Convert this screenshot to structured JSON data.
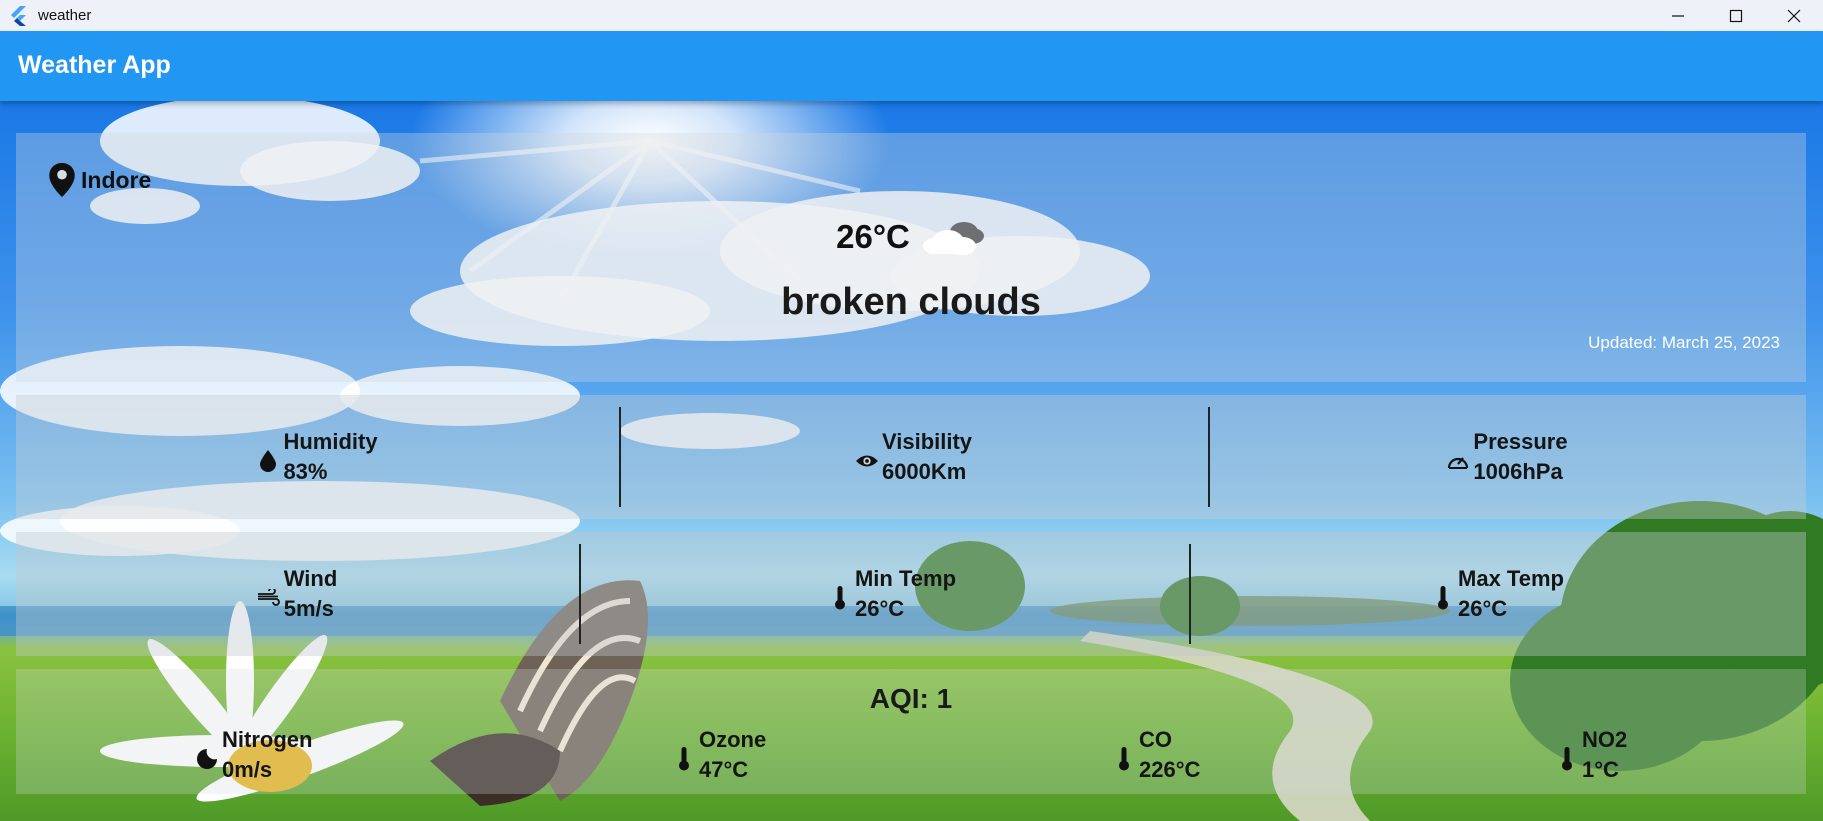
{
  "window": {
    "title": "weather",
    "controls": {
      "minimize": "minimize-icon",
      "maximize": "maximize-icon",
      "close": "close-icon"
    }
  },
  "appbar": {
    "title": "Weather App",
    "color": "#2196f3"
  },
  "current": {
    "city": "Indore",
    "temperature": "26°C",
    "condition_icon": "broken-clouds-icon",
    "description": "broken clouds",
    "updated": "Updated: March 25, 2023"
  },
  "details_row1": [
    {
      "icon": "water-drop-icon",
      "label": "Humidity",
      "value": "83%"
    },
    {
      "icon": "eye-icon",
      "label": "Visibility",
      "value": "6000Km"
    },
    {
      "icon": "speedometer-icon",
      "label": "Pressure",
      "value": "1006hPa"
    }
  ],
  "details_row2": [
    {
      "icon": "wind-icon",
      "label": "Wind",
      "value": "5m/s"
    },
    {
      "icon": "thermometer-icon",
      "label": "Min Temp",
      "value": "26°C"
    },
    {
      "icon": "thermometer-icon",
      "label": "Max Temp",
      "value": "26°C"
    }
  ],
  "aqi": {
    "title": "AQI: 1",
    "items": [
      {
        "icon": "moon-icon",
        "label": "Nitrogen",
        "value": "0m/s"
      },
      {
        "icon": "thermometer-icon",
        "label": "Ozone",
        "value": "47°C"
      },
      {
        "icon": "thermometer-icon",
        "label": "CO",
        "value": "226°C"
      },
      {
        "icon": "thermometer-icon",
        "label": "NO2",
        "value": "1°C"
      }
    ]
  }
}
